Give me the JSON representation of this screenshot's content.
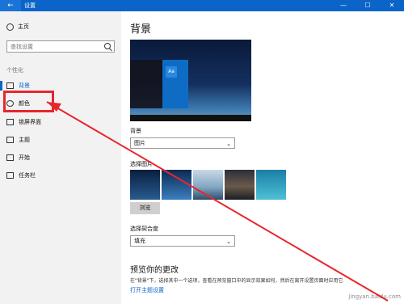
{
  "window": {
    "title": "设置",
    "back": "←",
    "minimize": "—",
    "maximize": "☐",
    "close": "✕"
  },
  "sidebar": {
    "home": "主页",
    "search_placeholder": "查找设置",
    "section": "个性化",
    "items": [
      {
        "label": "背景",
        "icon": "picture-icon"
      },
      {
        "label": "颜色",
        "icon": "palette-icon"
      },
      {
        "label": "锁屏界面",
        "icon": "lock-screen-icon"
      },
      {
        "label": "主题",
        "icon": "brush-icon"
      },
      {
        "label": "开始",
        "icon": "start-icon"
      },
      {
        "label": "任务栏",
        "icon": "taskbar-icon"
      }
    ]
  },
  "main": {
    "title": "背景",
    "preview_tile": "Aa",
    "background_label": "背景",
    "background_value": "图片",
    "choose_picture_label": "选择图片",
    "browse": "浏览",
    "fit_label": "选择契合度",
    "fit_value": "填充",
    "preview_title": "预览你的更改",
    "preview_desc": "在\"背景\"下，选择其中一个选项，查看在预览窗口中的显示效果如何，然后在离开设置页面时应用它",
    "theme_link": "打开主题设置"
  },
  "watermark": "jingyan.baidu.com",
  "colors": {
    "accent": "#0b64c8",
    "annotation": "#e8262d"
  }
}
